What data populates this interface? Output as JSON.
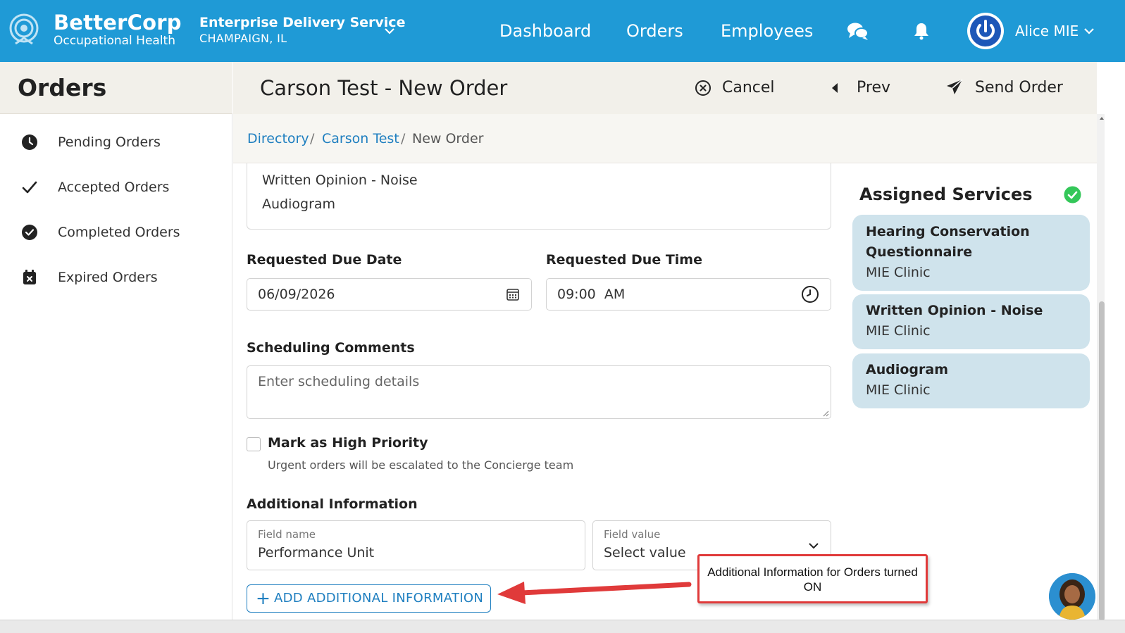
{
  "brand": {
    "name": "BetterCorp",
    "subtitle": "Occupational Health",
    "logo_icon": "target-logo-icon"
  },
  "company": {
    "name": "Enterprise Delivery Service",
    "location": "CHAMPAIGN, IL"
  },
  "nav": {
    "items": [
      {
        "label": "Dashboard"
      },
      {
        "label": "Orders"
      },
      {
        "label": "Employees"
      }
    ]
  },
  "user": {
    "name": "Alice MIE"
  },
  "sidebar": {
    "title": "Orders",
    "items": [
      {
        "label": "Pending Orders",
        "icon": "clock-icon"
      },
      {
        "label": "Accepted Orders",
        "icon": "checkmark-icon"
      },
      {
        "label": "Completed Orders",
        "icon": "check-circle-icon"
      },
      {
        "label": "Expired Orders",
        "icon": "calendar-x-icon"
      }
    ]
  },
  "header": {
    "title": "Carson Test - New Order",
    "cancel_label": "Cancel",
    "prev_label": "Prev",
    "send_label": "Send Order"
  },
  "breadcrumb": {
    "items": [
      "Directory",
      "Carson Test",
      "New Order"
    ],
    "separator": "/"
  },
  "selected_services": [
    "Written Opinion - Noise",
    "Audiogram"
  ],
  "form": {
    "due_date_label": "Requested Due Date",
    "due_date_value": "06/09/2026",
    "due_time_label": "Requested Due Time",
    "due_time_value": "09:00  AM",
    "comments_label": "Scheduling Comments",
    "comments_placeholder": "Enter scheduling details",
    "priority_label": "Mark as High Priority",
    "priority_checked": false,
    "priority_hint": "Urgent orders will be escalated to the Concierge team",
    "additional_label": "Additional Information",
    "field_name_label": "Field name",
    "field_name_value": "Performance Unit",
    "field_value_label": "Field value",
    "field_value_value": "Select value",
    "add_button_label": "ADD ADDITIONAL INFORMATION"
  },
  "assigned": {
    "title": "Assigned Services",
    "services": [
      {
        "name": "Hearing Conservation Questionnaire",
        "name_line1": "Hearing Conservation",
        "name_line2": "Questionnaire",
        "provider": "MIE Clinic"
      },
      {
        "name": "Written Opinion - Noise",
        "provider": "MIE Clinic"
      },
      {
        "name": "Audiogram",
        "provider": "MIE Clinic"
      }
    ]
  },
  "annotation": {
    "text": "Additional Information for Orders turned ON"
  },
  "colors": {
    "nav_bg": "#1f9ad6",
    "link": "#1f7fc0",
    "card_bg": "#cfe3ec",
    "success": "#34c759",
    "annotation": "#e03a3a"
  }
}
